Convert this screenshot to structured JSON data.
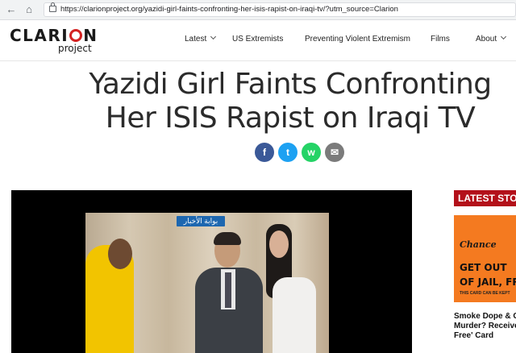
{
  "browser": {
    "url": "https://clarionproject.org/yazidi-girl-faints-confronting-her-isis-rapist-on-iraqi-tv/?utm_source=Clarion",
    "back_icon": "arrow-left",
    "home_icon": "house"
  },
  "site": {
    "logo_main_left": "CLARI",
    "logo_main_right": "N",
    "logo_sub": "project",
    "accent_color": "#d32222"
  },
  "nav": {
    "items": [
      {
        "label": "Latest",
        "dropdown": true
      },
      {
        "label": "US Extremists"
      },
      {
        "label": "Preventing Violent Extremism"
      },
      {
        "label": "Films"
      },
      {
        "label": "About",
        "dropdown": true
      }
    ]
  },
  "article": {
    "title_line1": "Yazidi Girl Faints Confronting",
    "title_line2": "Her ISIS Rapist on Iraqi TV"
  },
  "share": {
    "facebook_glyph": "f",
    "twitter_glyph": "t",
    "whatsapp_glyph": "w",
    "email_glyph": "✉"
  },
  "video": {
    "badge_text": "بوابة الأخبار"
  },
  "sidebar": {
    "latest_label": "LATEST STO",
    "ad": {
      "brand": "Chance",
      "line1": "GET OUT",
      "line2": "OF JAIL, FR",
      "small": "THIS CARD CAN BE KEPT"
    },
    "story_lines": [
      "Smoke Dope & Co",
      "Murder? Receive",
      "Free' Card"
    ]
  }
}
